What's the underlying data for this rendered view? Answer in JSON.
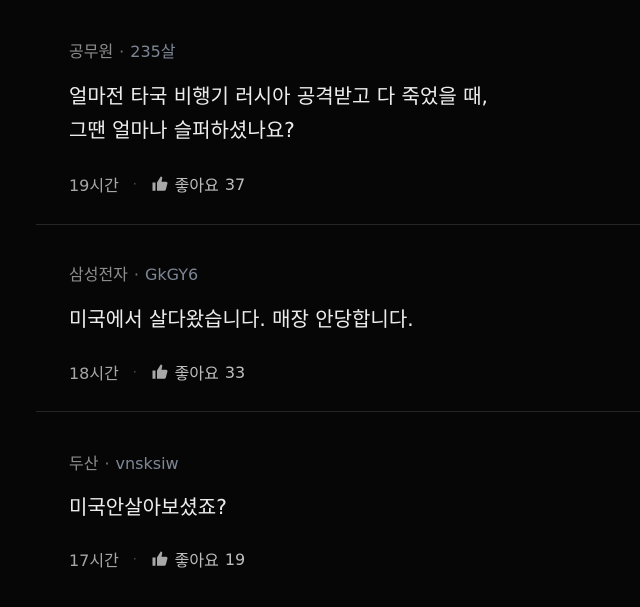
{
  "comments": [
    {
      "author": "공무원",
      "user_id": "235살",
      "text": "얼마전  타국 비행기  러시아 공격받고  다 죽었을 때,\n그땐 얼마나 슬퍼하셨나요?",
      "time": "19시간",
      "like_label": "좋아요",
      "likes": "37"
    },
    {
      "author": "삼성전자",
      "user_id": "GkGY6",
      "text": "미국에서 살다왔습니다. 매장 안당합니다.",
      "time": "18시간",
      "like_label": "좋아요",
      "likes": "33"
    },
    {
      "author": "두산",
      "user_id": "vnsksiw",
      "text": "미국안살아보셨죠?",
      "time": "17시간",
      "like_label": "좋아요",
      "likes": "19"
    }
  ],
  "separator": "·",
  "icons": {
    "like": "thumbs-up-icon"
  },
  "colors": {
    "background": "#060606",
    "text": "#ececec",
    "meta": "#8c8c8c",
    "divider": "#262626"
  }
}
